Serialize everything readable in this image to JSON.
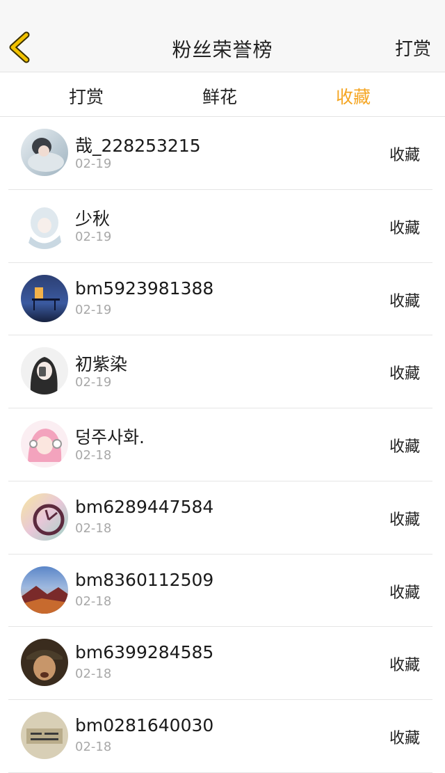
{
  "header": {
    "title": "粉丝荣誉榜",
    "action_label": "打赏",
    "back_icon": "chevron-left-icon",
    "accent_color": "#f5a623"
  },
  "tabs": [
    {
      "label": "打赏",
      "active": false
    },
    {
      "label": "鲜花",
      "active": false
    },
    {
      "label": "收藏",
      "active": true
    }
  ],
  "fans": [
    {
      "name": "哉_228253215",
      "date": "02-19",
      "type": "收藏"
    },
    {
      "name": "少秋",
      "date": "02-19",
      "type": "收藏"
    },
    {
      "name": "bm5923981388",
      "date": "02-19",
      "type": "收藏"
    },
    {
      "name": "初紫染",
      "date": "02-19",
      "type": "收藏"
    },
    {
      "name": "덩주사화.",
      "date": "02-18",
      "type": "收藏"
    },
    {
      "name": "bm6289447584",
      "date": "02-18",
      "type": "收藏"
    },
    {
      "name": "bm8360112509",
      "date": "02-18",
      "type": "收藏"
    },
    {
      "name": "bm6399284585",
      "date": "02-18",
      "type": "收藏"
    },
    {
      "name": "bm0281640030",
      "date": "02-18",
      "type": "收藏"
    }
  ]
}
